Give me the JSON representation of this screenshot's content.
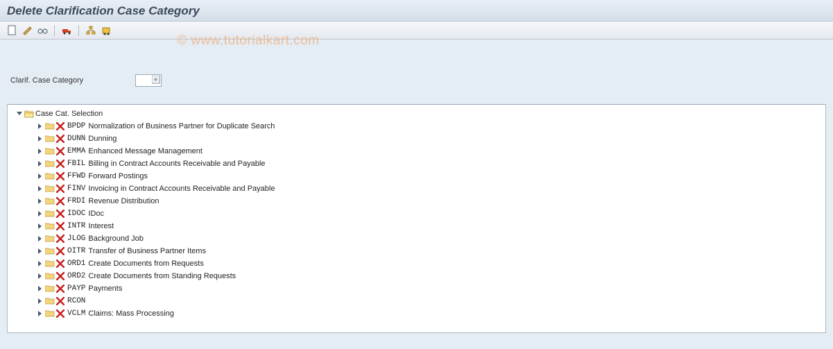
{
  "title": "Delete Clarification Case Category",
  "watermark": "© www.tutorialkart.com",
  "toolbar": {
    "icons": [
      "new",
      "edit",
      "glasses",
      "truck",
      "hierarchy",
      "transport"
    ]
  },
  "field": {
    "label": "Clarif. Case Category",
    "value": ""
  },
  "tree": {
    "root": "Case Cat. Selection",
    "items": [
      {
        "code": "BPDP",
        "text": "Normalization of Business Partner for Duplicate Search"
      },
      {
        "code": "DUNN",
        "text": "Dunning"
      },
      {
        "code": "EMMA",
        "text": "Enhanced Message Management"
      },
      {
        "code": "FBIL",
        "text": "Billing in Contract Accounts Receivable and Payable"
      },
      {
        "code": "FFWD",
        "text": "Forward Postings"
      },
      {
        "code": "FINV",
        "text": "Invoicing in Contract Accounts Receivable and Payable"
      },
      {
        "code": "FRDI",
        "text": "Revenue Distribution"
      },
      {
        "code": "IDOC",
        "text": "IDoc"
      },
      {
        "code": "INTR",
        "text": "Interest"
      },
      {
        "code": "JLOG",
        "text": "Background Job"
      },
      {
        "code": "OITR",
        "text": "Transfer of Business Partner Items"
      },
      {
        "code": "ORD1",
        "text": "Create Documents from Requests"
      },
      {
        "code": "ORD2",
        "text": "Create Documents from Standing Requests"
      },
      {
        "code": "PAYP",
        "text": "Payments"
      },
      {
        "code": "RCON",
        "text": ""
      },
      {
        "code": "VCLM",
        "text": "Claims: Mass Processing"
      }
    ]
  }
}
